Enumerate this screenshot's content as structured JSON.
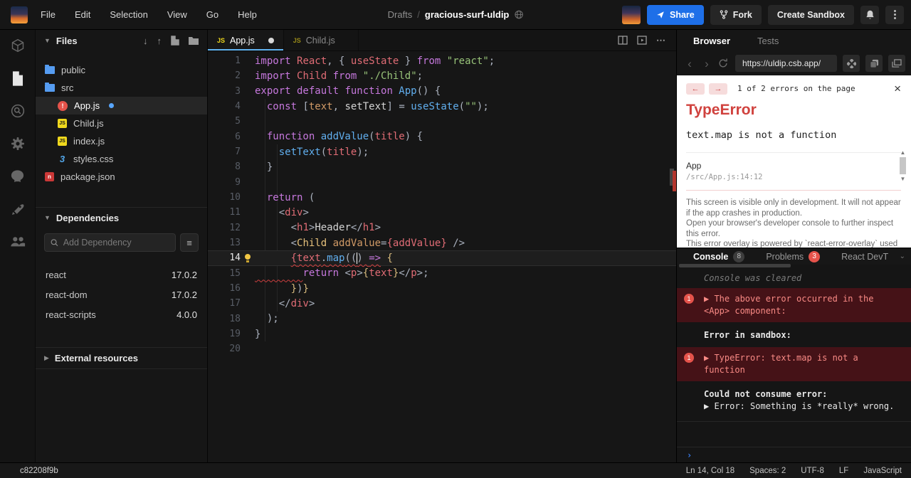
{
  "header": {
    "menu": [
      "File",
      "Edit",
      "Selection",
      "View",
      "Go",
      "Help"
    ],
    "breadcrumb": {
      "section": "Drafts",
      "separator": "/",
      "title": "gracious-surf-uldip"
    },
    "actions": {
      "share": "Share",
      "fork": "Fork",
      "create_sandbox": "Create Sandbox"
    }
  },
  "activity_bar": {
    "icons": [
      "sandbox-cube",
      "file-explorer",
      "search",
      "settings",
      "github",
      "deployment-rocket",
      "live-collaboration"
    ]
  },
  "sidebar": {
    "files": {
      "title": "Files",
      "items": [
        {
          "name": "public",
          "icon": "folder",
          "indent": 0
        },
        {
          "name": "src",
          "icon": "folder",
          "indent": 0
        },
        {
          "name": "App.js",
          "icon": "error",
          "indent": 1,
          "selected": true,
          "modified": true
        },
        {
          "name": "Child.js",
          "icon": "js",
          "indent": 1
        },
        {
          "name": "index.js",
          "icon": "js",
          "indent": 1
        },
        {
          "name": "styles.css",
          "icon": "css",
          "indent": 1
        },
        {
          "name": "package.json",
          "icon": "npm",
          "indent": 0
        }
      ]
    },
    "dependencies": {
      "title": "Dependencies",
      "search_placeholder": "Add Dependency",
      "packages": [
        {
          "name": "react",
          "version": "17.0.2"
        },
        {
          "name": "react-dom",
          "version": "17.0.2"
        },
        {
          "name": "react-scripts",
          "version": "4.0.0"
        }
      ]
    },
    "external": {
      "title": "External resources"
    }
  },
  "editor": {
    "tabs": [
      {
        "label": "App.js",
        "active": true,
        "modified": true
      },
      {
        "label": "Child.js",
        "active": false,
        "modified": false
      }
    ],
    "lines": [
      {
        "n": 1,
        "tokens": [
          {
            "t": "import ",
            "c": "kw"
          },
          {
            "t": "React",
            "c": "var"
          },
          {
            "t": ", { ",
            "c": "pun"
          },
          {
            "t": "useState",
            "c": "var"
          },
          {
            "t": " } ",
            "c": "pun"
          },
          {
            "t": "from",
            "c": "kw"
          },
          {
            "t": " ",
            "c": "pun"
          },
          {
            "t": "\"react\"",
            "c": "str"
          },
          {
            "t": ";",
            "c": "pun"
          }
        ]
      },
      {
        "n": 2,
        "tokens": [
          {
            "t": "import ",
            "c": "kw"
          },
          {
            "t": "Child",
            "c": "var"
          },
          {
            "t": " ",
            "c": "pun"
          },
          {
            "t": "from",
            "c": "kw"
          },
          {
            "t": " ",
            "c": "pun"
          },
          {
            "t": "\"./Child\"",
            "c": "str"
          },
          {
            "t": ";",
            "c": "pun"
          }
        ]
      },
      {
        "n": 3,
        "tokens": [
          {
            "t": "export default ",
            "c": "kw"
          },
          {
            "t": "function ",
            "c": "kw"
          },
          {
            "t": "App",
            "c": "fn"
          },
          {
            "t": "() {",
            "c": "pun"
          }
        ]
      },
      {
        "n": 4,
        "tokens": [
          {
            "t": "  ",
            "c": "pun"
          },
          {
            "t": "const",
            "c": "kw"
          },
          {
            "t": " [",
            "c": "pun"
          },
          {
            "t": "text",
            "c": "attr"
          },
          {
            "t": ", ",
            "c": "pun"
          },
          {
            "t": "setText",
            "c": "wht"
          },
          {
            "t": "] = ",
            "c": "pun"
          },
          {
            "t": "useState",
            "c": "fn"
          },
          {
            "t": "(",
            "c": "pun"
          },
          {
            "t": "\"\"",
            "c": "str"
          },
          {
            "t": ");",
            "c": "pun"
          }
        ]
      },
      {
        "n": 5,
        "tokens": []
      },
      {
        "n": 6,
        "tokens": [
          {
            "t": "  ",
            "c": "pun"
          },
          {
            "t": "function ",
            "c": "kw"
          },
          {
            "t": "addValue",
            "c": "fn"
          },
          {
            "t": "(",
            "c": "pun"
          },
          {
            "t": "title",
            "c": "var"
          },
          {
            "t": ") {",
            "c": "pun"
          }
        ]
      },
      {
        "n": 7,
        "tokens": [
          {
            "t": "    ",
            "c": "pun"
          },
          {
            "t": "setText",
            "c": "fn"
          },
          {
            "t": "(",
            "c": "pun"
          },
          {
            "t": "title",
            "c": "var"
          },
          {
            "t": ");",
            "c": "pun"
          }
        ]
      },
      {
        "n": 8,
        "tokens": [
          {
            "t": "  }",
            "c": "pun"
          }
        ]
      },
      {
        "n": 9,
        "tokens": []
      },
      {
        "n": 10,
        "tokens": [
          {
            "t": "  ",
            "c": "pun"
          },
          {
            "t": "return",
            "c": "kw"
          },
          {
            "t": " (",
            "c": "pun"
          }
        ]
      },
      {
        "n": 11,
        "tokens": [
          {
            "t": "    ",
            "c": "pun"
          },
          {
            "t": "<",
            "c": "pun"
          },
          {
            "t": "div",
            "c": "var"
          },
          {
            "t": ">",
            "c": "pun"
          }
        ]
      },
      {
        "n": 12,
        "tokens": [
          {
            "t": "      ",
            "c": "pun"
          },
          {
            "t": "<",
            "c": "pun"
          },
          {
            "t": "h1",
            "c": "var"
          },
          {
            "t": ">",
            "c": "pun"
          },
          {
            "t": "Header",
            "c": "wht"
          },
          {
            "t": "</",
            "c": "pun"
          },
          {
            "t": "h1",
            "c": "var"
          },
          {
            "t": ">",
            "c": "pun"
          }
        ]
      },
      {
        "n": 13,
        "tokens": [
          {
            "t": "      ",
            "c": "pun"
          },
          {
            "t": "<",
            "c": "pun"
          },
          {
            "t": "Child",
            "c": "comp"
          },
          {
            "t": " ",
            "c": "pun"
          },
          {
            "t": "addValue",
            "c": "attr"
          },
          {
            "t": "=",
            "c": "pun"
          },
          {
            "t": "{",
            "c": "var"
          },
          {
            "t": "addValue",
            "c": "var"
          },
          {
            "t": "}",
            "c": "var"
          },
          {
            "t": " />",
            "c": "pun"
          }
        ]
      },
      {
        "n": 14,
        "active": true,
        "bulb": true,
        "tokens": [
          {
            "t": "      ",
            "c": "pun"
          },
          {
            "t": "{",
            "c": "var sqg"
          },
          {
            "t": "text",
            "c": "var sqg"
          },
          {
            "t": ".",
            "c": "pun sqg"
          },
          {
            "t": "map",
            "c": "fn sqg"
          },
          {
            "t": "((",
            "c": "pun sqg"
          },
          {
            "c": "cursor"
          },
          {
            "t": ") ",
            "c": "pun sqg"
          },
          {
            "t": "=>",
            "c": "kw sqg"
          },
          {
            "t": " ",
            "c": "pun"
          },
          {
            "t": "{",
            "c": "gold"
          }
        ]
      },
      {
        "n": 15,
        "tokens": [
          {
            "t": "        ",
            "c": "pun sqg"
          },
          {
            "t": "return",
            "c": "kw"
          },
          {
            "t": " ",
            "c": "pun"
          },
          {
            "t": "<",
            "c": "pun"
          },
          {
            "t": "p",
            "c": "var"
          },
          {
            "t": ">",
            "c": "pun"
          },
          {
            "t": "{",
            "c": "gold"
          },
          {
            "t": "text",
            "c": "var"
          },
          {
            "t": "}",
            "c": "gold"
          },
          {
            "t": "</",
            "c": "pun"
          },
          {
            "t": "p",
            "c": "var"
          },
          {
            "t": ">;",
            "c": "pun"
          }
        ]
      },
      {
        "n": 16,
        "tokens": [
          {
            "t": "      ",
            "c": "pun"
          },
          {
            "t": "}",
            "c": "gold"
          },
          {
            "t": ")",
            "c": "pun"
          },
          {
            "t": "}",
            "c": "gold"
          }
        ]
      },
      {
        "n": 17,
        "tokens": [
          {
            "t": "    ",
            "c": "pun"
          },
          {
            "t": "</",
            "c": "pun"
          },
          {
            "t": "div",
            "c": "var"
          },
          {
            "t": ">",
            "c": "pun"
          }
        ]
      },
      {
        "n": 18,
        "tokens": [
          {
            "t": "  );",
            "c": "pun"
          }
        ]
      },
      {
        "n": 19,
        "tokens": [
          {
            "t": "}",
            "c": "pun"
          }
        ]
      },
      {
        "n": 20,
        "tokens": []
      }
    ]
  },
  "browser": {
    "tabs": [
      {
        "label": "Browser",
        "active": true
      },
      {
        "label": "Tests",
        "active": false
      }
    ],
    "url": "https://uldip.csb.app/",
    "overlay": {
      "counter": "1 of 2 errors on the page",
      "title": "TypeError",
      "message": "text.map is not a function",
      "frame": {
        "fn": "App",
        "loc": "/src/App.js:14:12"
      },
      "footer": [
        "This screen is visible only in development. It will not appear if the app crashes in production.",
        "Open your browser's developer console to further inspect this error.",
        "This error overlay is powered by `react-error-overlay` used in `create-react-app`."
      ]
    }
  },
  "console": {
    "tabs": [
      {
        "label": "Console",
        "badge": "8",
        "badge_style": "gray",
        "active": true
      },
      {
        "label": "Problems",
        "badge": "3",
        "badge_style": "red",
        "active": false
      },
      {
        "label": "React DevT",
        "active": false
      }
    ],
    "rows": [
      {
        "type": "muted",
        "text": "Console was cleared"
      },
      {
        "type": "error",
        "badge": "1",
        "text": "▶ The above error occurred in the <App> component:"
      },
      {
        "type": "log",
        "lines": [
          {
            "text": "Error in sandbox:",
            "bold": true
          }
        ]
      },
      {
        "type": "error",
        "badge": "1",
        "text": "▶ TypeError: text.map is not a function"
      },
      {
        "type": "log",
        "lines": [
          {
            "text": "Could not consume error:",
            "bold": true
          },
          {
            "text": "▶ Error: Something is *really* wrong.",
            "bold": false
          }
        ]
      }
    ]
  },
  "status_bar": {
    "left": "c82208f9b",
    "items": [
      "Ln 14, Col 18",
      "Spaces: 2",
      "UTF-8",
      "LF",
      "JavaScript"
    ]
  },
  "colors": {
    "accent_blue": "#1e6fe8",
    "error_red": "#e5534b",
    "tab_underline": "#61b3f0"
  }
}
